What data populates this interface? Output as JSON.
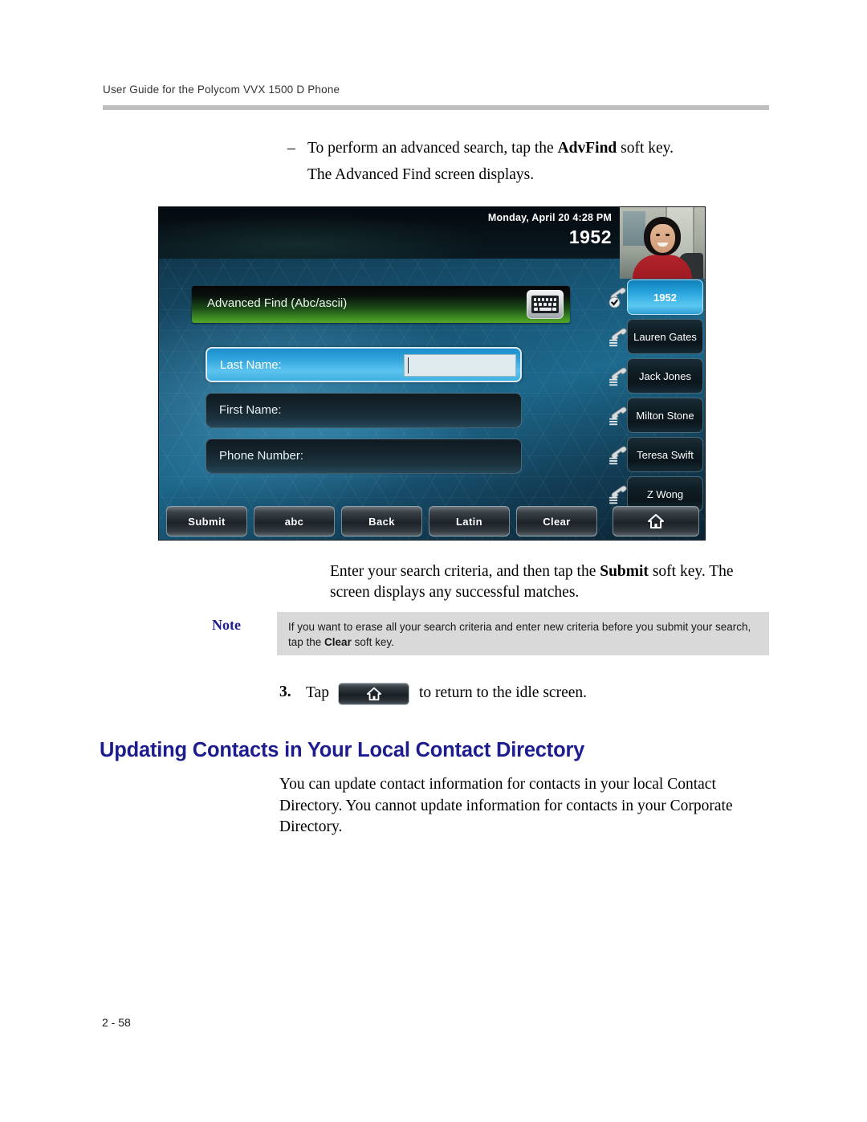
{
  "header": {
    "running_head": "User Guide for the Polycom VVX 1500 D Phone"
  },
  "bullet": {
    "dash": "–",
    "line1_a": "To perform an advanced search, tap the ",
    "line1_bold": "AdvFind",
    "line1_b": " soft key.",
    "line2": "The Advanced Find screen displays."
  },
  "phone_screen": {
    "status_bar": {
      "datetime": "Monday, April 20  4:28 PM",
      "extension": "1952"
    },
    "title_bar": {
      "title": "Advanced Find (Abc/ascii)",
      "keyboard_icon": "keyboard-icon"
    },
    "fields": [
      {
        "label": "Last Name:",
        "value": "",
        "state": "active"
      },
      {
        "label": "First Name:",
        "value": "",
        "state": "inactive"
      },
      {
        "label": "Phone Number:",
        "value": "",
        "state": "inactive"
      }
    ],
    "line_keys": [
      {
        "label": "1952",
        "state": "active",
        "icon": "handset-registered-icon"
      },
      {
        "label": "Lauren Gates",
        "state": "idle",
        "icon": "handset-icon"
      },
      {
        "label": "Jack Jones",
        "state": "idle",
        "icon": "handset-icon"
      },
      {
        "label": "Milton Stone",
        "state": "idle",
        "icon": "handset-icon"
      },
      {
        "label": "Teresa Swift",
        "state": "idle",
        "icon": "handset-icon"
      },
      {
        "label": "Z Wong",
        "state": "idle",
        "icon": "handset-icon"
      }
    ],
    "soft_keys": [
      {
        "label": "Submit"
      },
      {
        "label": "abc"
      },
      {
        "label": "Back"
      },
      {
        "label": "Latin"
      },
      {
        "label": "Clear"
      },
      {
        "label": "",
        "icon": "home-icon"
      }
    ],
    "colors": {
      "active_line_key": "#2ea2da",
      "active_field": "#3fb0e3",
      "title_bar_green": "#57a62b",
      "wallpaper_blue": "#1d6a8e"
    }
  },
  "para_after": {
    "text_a": "Enter your search criteria, and then tap the ",
    "bold": "Submit",
    "text_b": " soft key. The screen displays any successful matches."
  },
  "note": {
    "label": "Note",
    "text_a": "If you want to erase all your search criteria and enter new criteria before you submit your search, tap the ",
    "bold": "Clear",
    "text_b": " soft key."
  },
  "step3": {
    "number": "3.",
    "tap": "Tap",
    "button_icon": "home-icon",
    "tail": "to return to the idle screen."
  },
  "section": {
    "heading": "Updating Contacts in Your Local Contact Directory",
    "paragraph": "You can update contact information for contacts in your local Contact Directory. You cannot update information for contacts in your Corporate Directory."
  },
  "footer": {
    "page_number": "2 - 58"
  }
}
